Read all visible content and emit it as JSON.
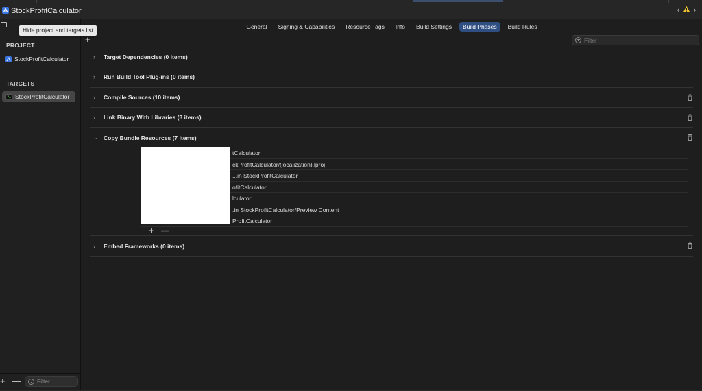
{
  "window": {
    "title": "StockProfitCalculator"
  },
  "colors": {
    "accent": "#2f4f82",
    "brand_icon": "#3a74e0",
    "background": "#1e1e1e"
  },
  "tooltip": "Hide project and targets list",
  "sidebar": {
    "project_header": "PROJECT",
    "project_item": "StockProfitCalculator",
    "targets_header": "TARGETS",
    "target_item": "StockProfitCalculator",
    "filter_placeholder": "Filter"
  },
  "tabs": [
    {
      "label": "General"
    },
    {
      "label": "Signing & Capabilities"
    },
    {
      "label": "Resource Tags"
    },
    {
      "label": "Info"
    },
    {
      "label": "Build Settings"
    },
    {
      "label": "Build Phases",
      "active": true
    },
    {
      "label": "Build Rules"
    }
  ],
  "toolbar": {
    "add_label": "+",
    "filter_placeholder": "Filter"
  },
  "phases": [
    {
      "title": "Target Dependencies (0 items)"
    },
    {
      "title": "Run Build Tool Plug-ins (0 items)"
    },
    {
      "title": "Compile Sources (10 items)"
    },
    {
      "title": "Link Binary With Libraries (3 items)"
    },
    {
      "title": "Copy Bundle Resources (7 items)"
    },
    {
      "title": "Embed Frameworks (0 items)"
    }
  ],
  "resources": [
    "tCalculator",
    "ckProfitCalculator/(localization).lproj",
    "...in StockProfitCalculator",
    "ofitCalculator",
    "lculator",
    ".in StockProfitCalculator/Preview Content",
    "ProfitCalculator"
  ]
}
